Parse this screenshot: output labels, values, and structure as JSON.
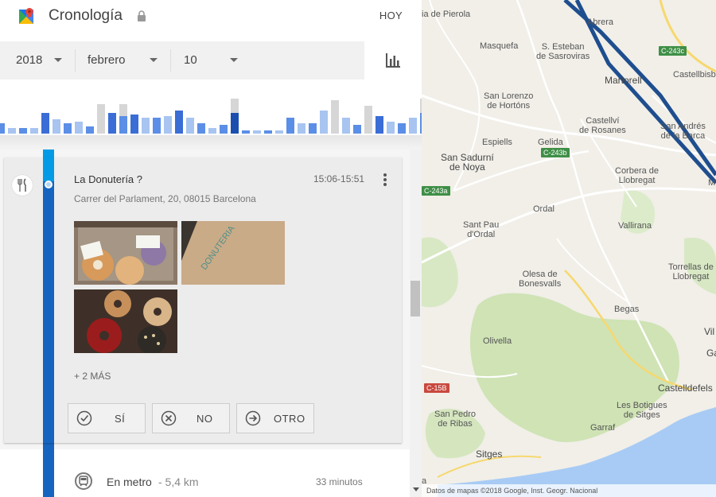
{
  "header": {
    "title": "Cronología",
    "today_label": "HOY"
  },
  "date_selector": {
    "year": "2018",
    "month": "febrero",
    "day": "10"
  },
  "histogram": {
    "values": [
      0.3,
      0.15,
      0.15,
      0.15,
      0.6,
      0.4,
      0.3,
      0.35,
      0.2,
      0.85,
      0.6,
      0.85,
      0.55,
      0.45,
      0.45,
      0.5,
      0.65,
      0.45,
      0.3,
      0.15,
      0.25,
      1.0,
      0.1,
      0.1,
      0.1,
      0.1,
      0.45,
      0.3,
      0.3,
      0.65,
      0.95,
      0.45,
      0.25,
      0.8,
      0.5,
      0.35,
      0.3,
      0.45,
      1.0,
      0.75,
      0.55,
      0.4,
      0.45,
      0.35,
      0.8
    ],
    "highlight_index": 21,
    "colors": {
      "light": "#a8c4f0",
      "mid": "#5b8ee6",
      "dark": "#3b6dd6",
      "gray": "#d6d6d6",
      "selected": "#1a4fb0"
    }
  },
  "place": {
    "name": "La Donutería ?",
    "time_range": "15:06-15:51",
    "address": "Carrer del Parlament, 20, 08015 Barcelona",
    "photo_stamp": "DONUTERIA",
    "more_photos": "+ 2 MÁS",
    "icon": "restaurant-icon"
  },
  "confirm_buttons": {
    "yes": "SÍ",
    "no": "NO",
    "other": "OTRO"
  },
  "movement": {
    "mode": "En metro",
    "distance": "- 5,4 km",
    "duration": "33 minutos"
  },
  "map": {
    "places": [
      {
        "name": "ia de Pierola"
      },
      {
        "name": "Abrera"
      },
      {
        "name": "Masquefa"
      },
      {
        "name": "S. Esteban\nde Sasroviras"
      },
      {
        "name": "Martorell"
      },
      {
        "name": "Castellbisb"
      },
      {
        "name": "San Lorenzo\nde Hortóns"
      },
      {
        "name": "Castellví\nde Rosanes"
      },
      {
        "name": "San Andrés\nde la Barca"
      },
      {
        "name": "Espiells"
      },
      {
        "name": "Gelida"
      },
      {
        "name": "San Sadurní\nde Noya"
      },
      {
        "name": "Corbera de\nLlobregat"
      },
      {
        "name": "M"
      },
      {
        "name": "Ordal"
      },
      {
        "name": "Sant Pau\nd'Ordal"
      },
      {
        "name": "Vallirana"
      },
      {
        "name": "Olesa de\nBonesvalls"
      },
      {
        "name": "Torrellas de\nLlobregat"
      },
      {
        "name": "Begas"
      },
      {
        "name": "Vil"
      },
      {
        "name": "Olivella"
      },
      {
        "name": "Ga"
      },
      {
        "name": "Castelldefels"
      },
      {
        "name": "San Pedro\nde Ribas"
      },
      {
        "name": "Les Botigues\nde Sitges"
      },
      {
        "name": "Garraf"
      },
      {
        "name": "Sitges"
      },
      {
        "name": "a"
      }
    ],
    "road_badges": [
      "C-243c",
      "C-243b",
      "C-243a",
      "C-15B"
    ],
    "attribution": "Datos de mapas ©2018 Google, Inst. Geogr. Nacional"
  }
}
